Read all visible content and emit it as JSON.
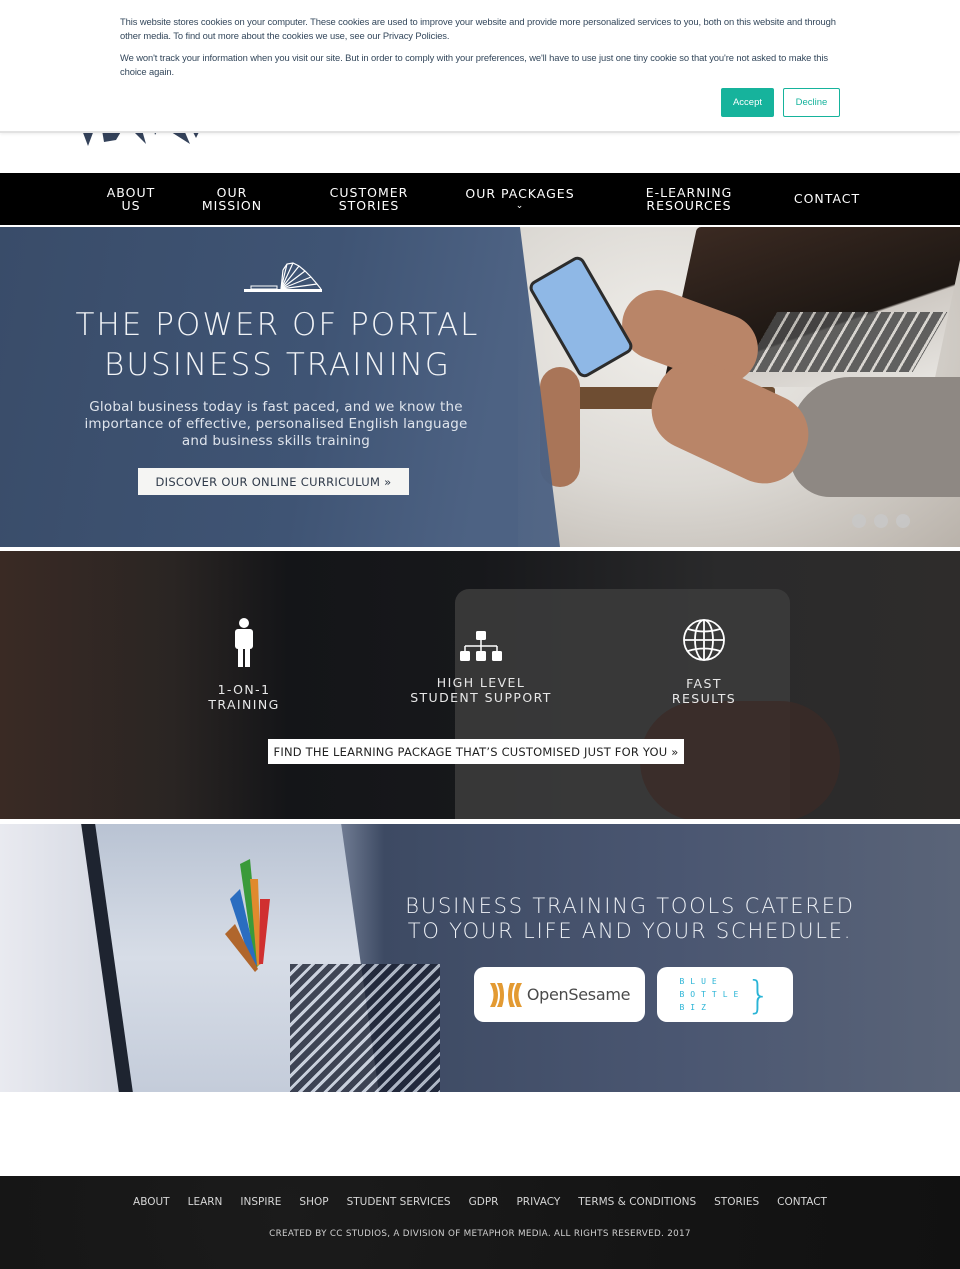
{
  "cookie_banner": {
    "text1": "This website stores cookies on your computer. These cookies are used to improve your website and provide more personalized services to you, both on this website and through other media. To find out more about the cookies we use, see our Privacy Policies.",
    "text2": "We won't track your information when you visit our site. But in order to comply with your preferences, we'll have to use just one tiny cookie so that you're not asked to make this choice again.",
    "accept_label": "Accept",
    "decline_label": "Decline",
    "accent_color": "#16b39c"
  },
  "nav": {
    "items": [
      {
        "line1": "ABOUT",
        "line2": "US"
      },
      {
        "line1": "OUR",
        "line2": "MISSION"
      },
      {
        "line1": "CUSTOMER",
        "line2": "STORIES"
      },
      {
        "line1": "OUR PACKAGES",
        "line2": "⌄"
      },
      {
        "line1": "E-LEARNING",
        "line2": "RESOURCES"
      },
      {
        "line1": "CONTACT",
        "line2": ""
      }
    ]
  },
  "hero": {
    "icon": "open-book-laptop-icon",
    "title_line1": "THE POWER OF PORTAL",
    "title_line2": "BUSINESS TRAINING",
    "subtitle_line1": "Global business today is fast paced, and we know the",
    "subtitle_line2": "importance of effective, personalised English language",
    "subtitle_line3": "and business skills training",
    "cta_label": "DISCOVER OUR ONLINE CURRICULUM »",
    "slide_count": 3
  },
  "features": {
    "items": [
      {
        "icon": "person-icon",
        "line1": "1-ON-1",
        "line2": "TRAINING"
      },
      {
        "icon": "org-chart-icon",
        "line1": "HIGH LEVEL",
        "line2": "STUDENT SUPPORT"
      },
      {
        "icon": "globe-icon",
        "line1": "FAST",
        "line2": "RESULTS"
      }
    ],
    "cta_label": "FIND THE LEARNING PACKAGE THAT’S CUSTOMISED JUST FOR YOU »"
  },
  "tools": {
    "title_line1": "BUSINESS TRAINING TOOLS CATERED",
    "title_line2": "TO YOUR LIFE AND YOUR SCHEDULE.",
    "partners": [
      {
        "name": "OpenSesame"
      },
      {
        "name_lines": [
          "BLUE",
          "BOTTLE",
          "BIZ"
        ]
      }
    ]
  },
  "footer": {
    "links": [
      "ABOUT",
      "LEARN",
      "INSPIRE",
      "SHOP",
      "STUDENT SERVICES",
      "GDPR",
      "PRIVACY",
      "TERMS & CONDITIONS",
      "STORIES",
      "CONTACT"
    ],
    "copyright": "CREATED BY CC STUDIOS, A DIVISION OF METAPHOR MEDIA. ALL RIGHTS RESERVED. 2017"
  }
}
